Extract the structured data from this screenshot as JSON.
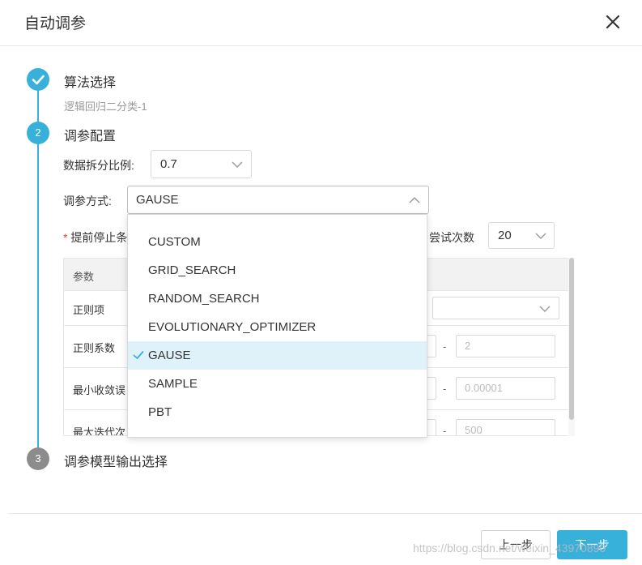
{
  "dialog": {
    "title": "自动调参"
  },
  "steps": [
    {
      "index": "1",
      "title": "算法选择",
      "subtitle": "逻辑回归二分类-1",
      "state": "done"
    },
    {
      "index": "2",
      "title": "调参配置",
      "state": "active"
    },
    {
      "index": "3",
      "title": "调参模型输出选择",
      "state": "pending"
    }
  ],
  "form": {
    "split_label": "数据拆分比例:",
    "split_value": "0.7",
    "method_label": "调参方式:",
    "method_value": "GAUSE",
    "early_stop_label": "提前停止条",
    "required_mark": "*",
    "tries_label": "尝试次数",
    "tries_value": "20"
  },
  "table": {
    "header": "参数",
    "rows": [
      {
        "name": "正则项"
      },
      {
        "name": "正则系数",
        "max": "2"
      },
      {
        "name": "最小收敛误",
        "max": "0.00001"
      },
      {
        "name": "最大迭代次",
        "max": "500"
      }
    ],
    "range_separator": "-"
  },
  "dropdown": {
    "options": [
      "CUSTOM",
      "GRID_SEARCH",
      "RANDOM_SEARCH",
      "EVOLUTIONARY_OPTIMIZER",
      "GAUSE",
      "SAMPLE",
      "PBT"
    ],
    "selected": "GAUSE"
  },
  "footer": {
    "prev_label": "上一步",
    "next_label": "下一步"
  },
  "watermark": "https://blog.csdn.net/weixin_43970890",
  "colors": {
    "accent": "#38b1da",
    "selected_bg": "#dff2f9",
    "pending": "#8c8c8c",
    "required": "#e5402b"
  }
}
